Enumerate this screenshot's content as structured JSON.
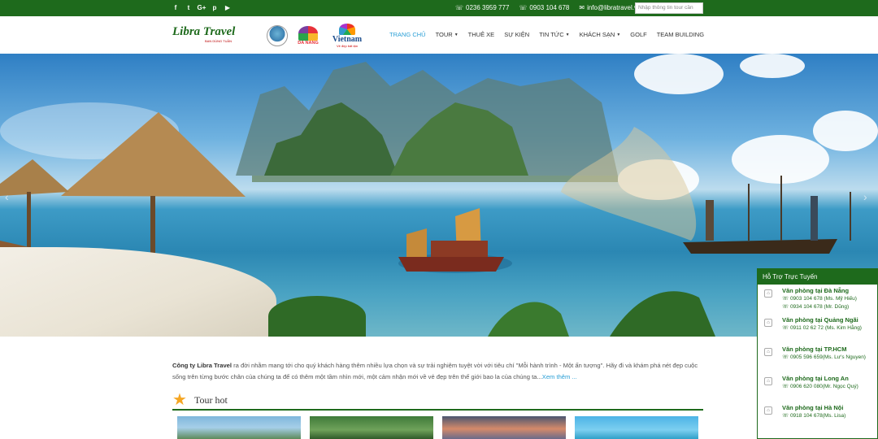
{
  "topbar": {
    "social": [
      "f",
      "t",
      "G+",
      "p",
      "▶"
    ],
    "phones": [
      "0236 3959 777",
      "0903 104 678"
    ],
    "email": "info@libratravel.vn",
    "search_placeholder": "Nhập thông tin tour cần"
  },
  "header": {
    "logo_text": "Libra Travel",
    "logo_sub": "BAN DÙNG TUẦN",
    "partners": {
      "danang": "DA NANG",
      "vietnam": "Vietnam",
      "vietnam_tagline": "Vẻ đẹp bất tận"
    },
    "nav": [
      {
        "label": "TRANG CHỦ",
        "active": true,
        "dropdown": false
      },
      {
        "label": "TOUR",
        "active": false,
        "dropdown": true
      },
      {
        "label": "THUÊ XE",
        "active": false,
        "dropdown": false
      },
      {
        "label": "SỰ KIỆN",
        "active": false,
        "dropdown": false
      },
      {
        "label": "TIN TỨC",
        "active": false,
        "dropdown": true
      },
      {
        "label": "KHÁCH SẠN",
        "active": false,
        "dropdown": true
      },
      {
        "label": "GOLF",
        "active": false,
        "dropdown": false
      },
      {
        "label": "TEAM BUILDING",
        "active": false,
        "dropdown": false
      }
    ]
  },
  "hero": {
    "prev_icon": "‹",
    "next_icon": "›"
  },
  "intro": {
    "company": "Công ty Libra Travel",
    "text": " ra đời nhằm mang tới cho quý khách hàng thêm nhiều lựa chọn và sự trải nghiệm tuyệt vời với tiêu chí \"Mỗi hành trình - Một ấn tượng\". Hãy đi và khám phá nét đẹp cuộc sống trên từng bước chân của chúng ta để có thêm một tầm nhìn mới, một cảm nhận mới về vẻ đẹp trên thế giới bao la của chúng ta...",
    "more": "Xem thêm ..."
  },
  "tour_hot": {
    "title": "Tour hot"
  },
  "support": {
    "title": "Hỗ Trợ Trực Tuyến",
    "offices": [
      {
        "name": "Văn phòng tại Đà Nẵng",
        "phones": [
          "0903 104 678 (Ms. Mỹ Hiếu)",
          "0934 104 678 (Mr. Dũng)"
        ]
      },
      {
        "name": "Văn phòng tại Quảng Ngãi",
        "phones": [
          "0911 02 62 72 (Ms. Kim Hằng)"
        ]
      },
      {
        "name": "Văn phòng tại TP.HCM",
        "phones": [
          "0905 596 659(Ms. Lư's Nguyen)"
        ]
      },
      {
        "name": "Văn phòng tại Long An",
        "phones": [
          "0906 620 080(Mr. Ngọc Quý)"
        ]
      },
      {
        "name": "Văn phòng tại Hà Nội",
        "phones": [
          "0918 104 678(Ms. Lisa)"
        ]
      }
    ]
  },
  "colors": {
    "brand_green": "#1e6a1c",
    "nav_active": "#2a9fd6"
  }
}
